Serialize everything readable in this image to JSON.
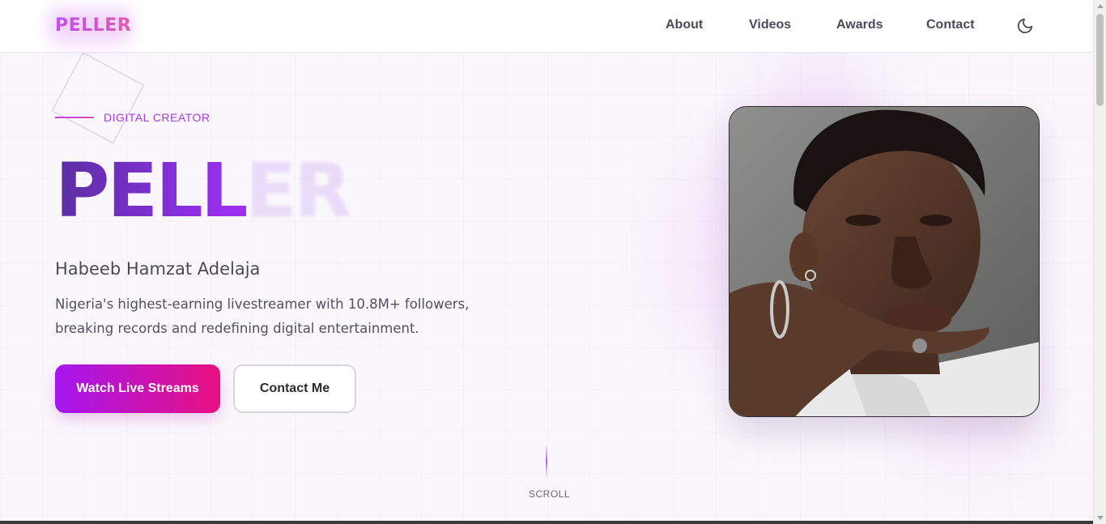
{
  "header": {
    "logo": "PELLER",
    "nav": [
      {
        "label": "About"
      },
      {
        "label": "Videos"
      },
      {
        "label": "Awards"
      },
      {
        "label": "Contact"
      }
    ],
    "theme_icon": "moon-icon"
  },
  "hero": {
    "eyebrow": "DIGITAL CREATOR",
    "title_solid": "PELL",
    "title_faded": "ER",
    "name": "Habeeb Hamzat Adelaja",
    "description": "Nigeria's highest-earning livestreamer with 10.8M+ followers, breaking records and redefining digital entertainment.",
    "primary_button": "Watch Live Streams",
    "secondary_button": "Contact Me",
    "scroll_label": "SCROLL"
  },
  "colors": {
    "accent_purple": "#a516f0",
    "accent_pink": "#e8107f",
    "eyebrow": "#a53ae0"
  },
  "portrait": {
    "icon": "portrait-photo"
  }
}
